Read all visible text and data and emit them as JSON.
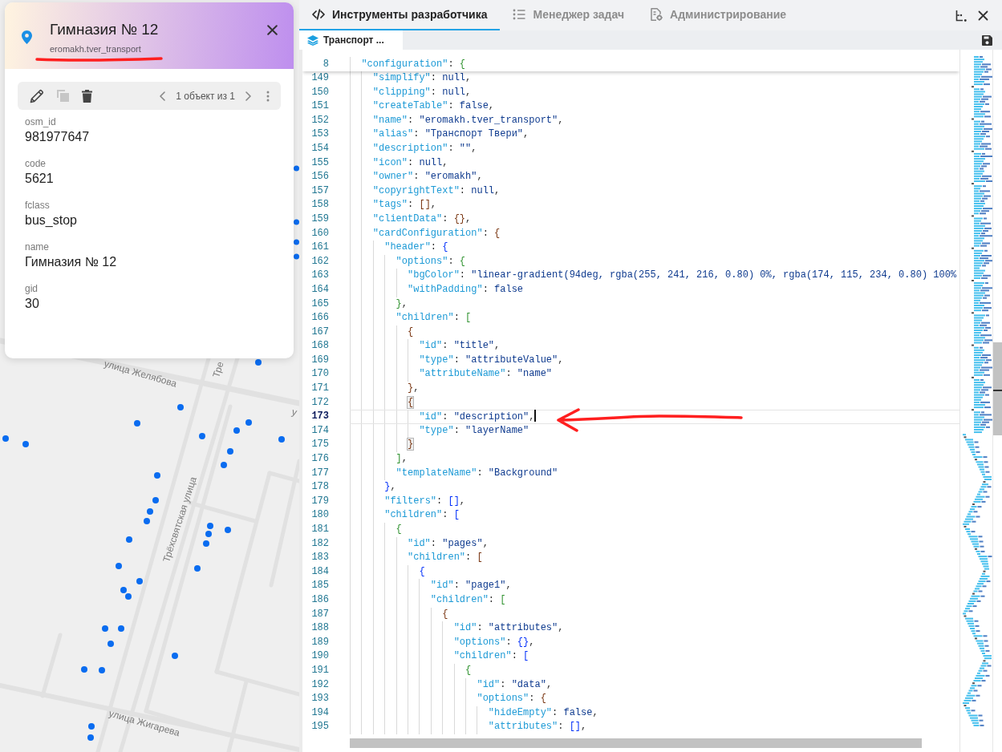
{
  "map": {
    "street_labels": [
      "улица Желябова",
      "Тре",
      "у",
      "Трёхсвятская улица",
      "улица Жигарева"
    ]
  },
  "feature_card": {
    "title": "Гимназия № 12",
    "layer_name": "eromakh.tver_transport",
    "toolbar": {
      "tools": [
        {
          "kind": "edit",
          "disabled": false
        },
        {
          "kind": "copy",
          "disabled": true
        },
        {
          "kind": "delete",
          "disabled": false
        }
      ],
      "pager": "1 объект из 1"
    },
    "attributes": [
      {
        "name": "osm_id",
        "value": "981977647"
      },
      {
        "name": "code",
        "value": "5621"
      },
      {
        "name": "fclass",
        "value": "bus_stop"
      },
      {
        "name": "name",
        "value": "Гимназия № 12"
      },
      {
        "name": "gid",
        "value": "30"
      }
    ]
  },
  "devtools": {
    "tabs": [
      {
        "label": "Инструменты разработчика",
        "kind": "code",
        "selected": true
      },
      {
        "label": "Менеджер задач",
        "kind": "list",
        "selected": false
      },
      {
        "label": "Администрирование",
        "kind": "admin",
        "selected": false
      }
    ],
    "file_tabs": [
      {
        "label": "Транспорт ...",
        "selected": true
      }
    ],
    "editor": {
      "sticky_line": {
        "number": "8",
        "text": "  \"configuration\": {"
      },
      "lines": [
        {
          "number": "149",
          "text": "    \"simplify\": null,",
          "current": false,
          "bracket_match": false
        },
        {
          "number": "150",
          "text": "    \"clipping\": null,",
          "current": false,
          "bracket_match": false
        },
        {
          "number": "151",
          "text": "    \"createTable\": false,",
          "current": false,
          "bracket_match": false
        },
        {
          "number": "152",
          "text": "    \"name\": \"eromakh.tver_transport\",",
          "current": false,
          "bracket_match": false
        },
        {
          "number": "153",
          "text": "    \"alias\": \"Транспорт Твери\",",
          "current": false,
          "bracket_match": false
        },
        {
          "number": "154",
          "text": "    \"description\": \"\",",
          "current": false,
          "bracket_match": false
        },
        {
          "number": "155",
          "text": "    \"icon\": null,",
          "current": false,
          "bracket_match": false
        },
        {
          "number": "156",
          "text": "    \"owner\": \"eromakh\",",
          "current": false,
          "bracket_match": false
        },
        {
          "number": "157",
          "text": "    \"copyrightText\": null,",
          "current": false,
          "bracket_match": false
        },
        {
          "number": "158",
          "text": "    \"tags\": [],",
          "current": false,
          "bracket_match": false
        },
        {
          "number": "159",
          "text": "    \"clientData\": {},",
          "current": false,
          "bracket_match": false
        },
        {
          "number": "160",
          "text": "    \"cardConfiguration\": {",
          "current": false,
          "bracket_match": false
        },
        {
          "number": "161",
          "text": "      \"header\": {",
          "current": false,
          "bracket_match": false
        },
        {
          "number": "162",
          "text": "        \"options\": {",
          "current": false,
          "bracket_match": false
        },
        {
          "number": "163",
          "text": "          \"bgColor\": \"linear-gradient(94deg, rgba(255, 241, 216, 0.80) 0%, rgba(174, 115, 234, 0.80) 100%",
          "current": false,
          "bracket_match": false
        },
        {
          "number": "164",
          "text": "          \"withPadding\": false",
          "current": false,
          "bracket_match": false
        },
        {
          "number": "165",
          "text": "        },",
          "current": false,
          "bracket_match": false
        },
        {
          "number": "166",
          "text": "        \"children\": [",
          "current": false,
          "bracket_match": false
        },
        {
          "number": "167",
          "text": "          {",
          "current": false,
          "bracket_match": false
        },
        {
          "number": "168",
          "text": "            \"id\": \"title\",",
          "current": false,
          "bracket_match": false
        },
        {
          "number": "169",
          "text": "            \"type\": \"attributeValue\",",
          "current": false,
          "bracket_match": false
        },
        {
          "number": "170",
          "text": "            \"attributeName\": \"name\"",
          "current": false,
          "bracket_match": false
        },
        {
          "number": "171",
          "text": "          },",
          "current": false,
          "bracket_match": false
        },
        {
          "number": "172",
          "text": "          {",
          "current": false,
          "bracket_match": true
        },
        {
          "number": "173",
          "text": "            \"id\": \"description\",",
          "current": true,
          "bracket_match": false
        },
        {
          "number": "174",
          "text": "            \"type\": \"layerName\"",
          "current": false,
          "bracket_match": false
        },
        {
          "number": "175",
          "text": "          }",
          "current": false,
          "bracket_match": true
        },
        {
          "number": "176",
          "text": "        ],",
          "current": false,
          "bracket_match": false
        },
        {
          "number": "177",
          "text": "        \"templateName\": \"Background\"",
          "current": false,
          "bracket_match": false
        },
        {
          "number": "178",
          "text": "      },",
          "current": false,
          "bracket_match": false
        },
        {
          "number": "179",
          "text": "      \"filters\": [],",
          "current": false,
          "bracket_match": false
        },
        {
          "number": "180",
          "text": "      \"children\": [",
          "current": false,
          "bracket_match": false
        },
        {
          "number": "181",
          "text": "        {",
          "current": false,
          "bracket_match": false
        },
        {
          "number": "182",
          "text": "          \"id\": \"pages\",",
          "current": false,
          "bracket_match": false
        },
        {
          "number": "183",
          "text": "          \"children\": [",
          "current": false,
          "bracket_match": false
        },
        {
          "number": "184",
          "text": "            {",
          "current": false,
          "bracket_match": false
        },
        {
          "number": "185",
          "text": "              \"id\": \"page1\",",
          "current": false,
          "bracket_match": false
        },
        {
          "number": "186",
          "text": "              \"children\": [",
          "current": false,
          "bracket_match": false
        },
        {
          "number": "187",
          "text": "                {",
          "current": false,
          "bracket_match": false
        },
        {
          "number": "188",
          "text": "                  \"id\": \"attributes\",",
          "current": false,
          "bracket_match": false
        },
        {
          "number": "189",
          "text": "                  \"options\": {},",
          "current": false,
          "bracket_match": false
        },
        {
          "number": "190",
          "text": "                  \"children\": [",
          "current": false,
          "bracket_match": false
        },
        {
          "number": "191",
          "text": "                    {",
          "current": false,
          "bracket_match": false
        },
        {
          "number": "192",
          "text": "                      \"id\": \"data\",",
          "current": false,
          "bracket_match": false
        },
        {
          "number": "193",
          "text": "                      \"options\": {",
          "current": false,
          "bracket_match": false
        },
        {
          "number": "194",
          "text": "                        \"hideEmpty\": false,",
          "current": false,
          "bracket_match": false
        },
        {
          "number": "195",
          "text": "                        \"attributes\": [],",
          "current": false,
          "bracket_match": false
        }
      ]
    }
  },
  "annotations": [
    {
      "kind": "underline"
    },
    {
      "kind": "arrow"
    }
  ]
}
